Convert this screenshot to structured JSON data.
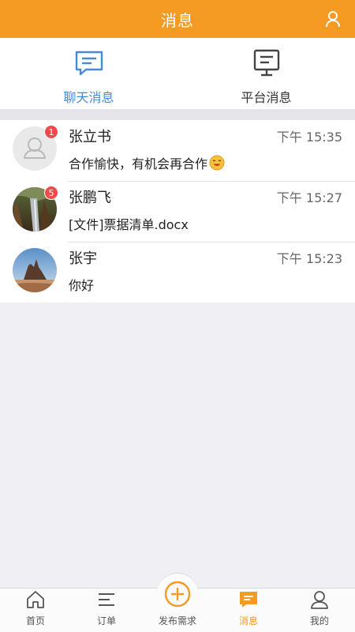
{
  "header": {
    "title": "消息",
    "user_icon": "user-icon"
  },
  "tabs": [
    {
      "label": "聊天消息",
      "icon": "chat-icon",
      "active": true
    },
    {
      "label": "平台消息",
      "icon": "monitor-icon",
      "active": false
    }
  ],
  "conversations": [
    {
      "name": "张立书",
      "time": "下午 15:35",
      "message": "合作愉快，有机会再合作",
      "badge": "1",
      "avatar": "default-avatar",
      "has_emoji": true
    },
    {
      "name": "张鹏飞",
      "time": "下午 15:27",
      "message": "[文件]票据清单.docx",
      "badge": "5",
      "avatar": "photo-waterfall"
    },
    {
      "name": "张宇",
      "time": "下午 15:23",
      "message": "你好",
      "badge": "",
      "avatar": "photo-rock"
    }
  ],
  "nav": [
    {
      "label": "首页",
      "icon": "home-icon"
    },
    {
      "label": "订单",
      "icon": "list-icon"
    },
    {
      "label": "发布需求",
      "icon": "plus-circle-icon"
    },
    {
      "label": "消息",
      "icon": "message-icon",
      "active": true
    },
    {
      "label": "我的",
      "icon": "profile-icon"
    }
  ],
  "colors": {
    "accent": "#f59a23",
    "tab_active": "#4a8ad4",
    "badge": "#f04a4a"
  }
}
